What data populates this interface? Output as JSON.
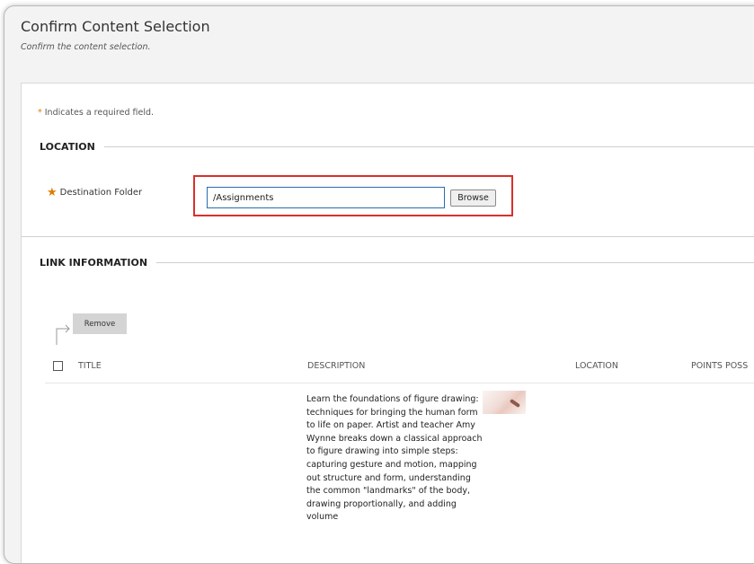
{
  "page": {
    "title": "Confirm Content Selection",
    "subtitle": "Confirm the content selection."
  },
  "form": {
    "required_note": "Indicates a required field.",
    "location_heading": "LOCATION",
    "destination_label": "Destination Folder",
    "destination_value": "/Assignments",
    "browse_label": "Browse",
    "link_heading": "LINK INFORMATION"
  },
  "table": {
    "remove_label": "Remove",
    "columns": [
      "TITLE",
      "DESCRIPTION",
      "LOCATION",
      "POINTS POSS"
    ],
    "rows": [
      {
        "title": "",
        "description": "Learn the foundations of figure drawing: techniques for bringing the human form to life on paper. Artist and teacher Amy Wynne breaks down a classical approach to figure drawing into simple steps: capturing gesture and motion, mapping out structure and form, understanding the common \"landmarks\" of the body, drawing proportionally, and adding volume"
      }
    ]
  },
  "icons": {
    "required": "asterisk-icon",
    "remove_arrow": "corner-arrow-icon"
  },
  "colors": {
    "required_star": "#e07b00",
    "highlight_border": "#d9302c",
    "input_border": "#2a6cb0"
  }
}
